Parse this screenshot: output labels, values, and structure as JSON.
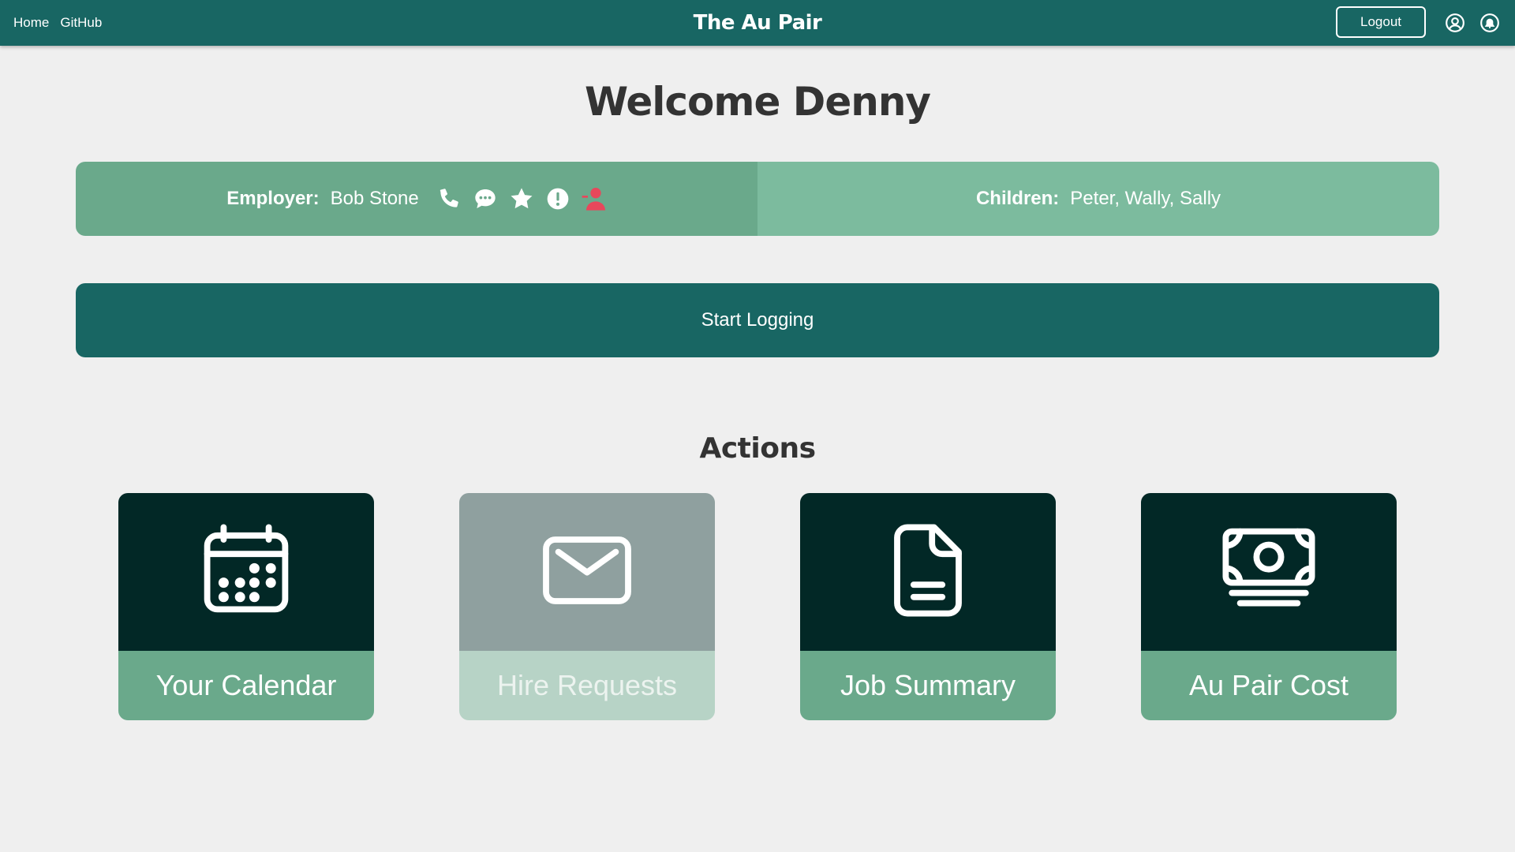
{
  "nav": {
    "links": [
      "Home",
      "GitHub"
    ],
    "brand": "The Au Pair",
    "logout_label": "Logout",
    "icons": [
      "user-circle-icon",
      "bell-icon"
    ]
  },
  "welcome": "Welcome Denny",
  "info": {
    "employer_label": "Employer:",
    "employer_name": "Bob Stone",
    "employer_icons": [
      "phone-icon",
      "chat-icon",
      "star-icon",
      "alert-icon",
      "remove-user-icon"
    ],
    "children_label": "Children:",
    "children_names": "Peter, Wally, Sally"
  },
  "start_logging_label": "Start Logging",
  "actions": {
    "title": "Actions",
    "cards": [
      {
        "label": "Your Calendar",
        "icon": "calendar-icon",
        "enabled": true
      },
      {
        "label": "Hire Requests",
        "icon": "envelope-icon",
        "enabled": false
      },
      {
        "label": "Job Summary",
        "icon": "document-icon",
        "enabled": true
      },
      {
        "label": "Au Pair Cost",
        "icon": "money-icon",
        "enabled": true
      }
    ]
  },
  "colors": {
    "primary": "#186663",
    "card_dark": "#022826",
    "card_label": "#6aa98b",
    "alert_red": "#e8475b"
  }
}
